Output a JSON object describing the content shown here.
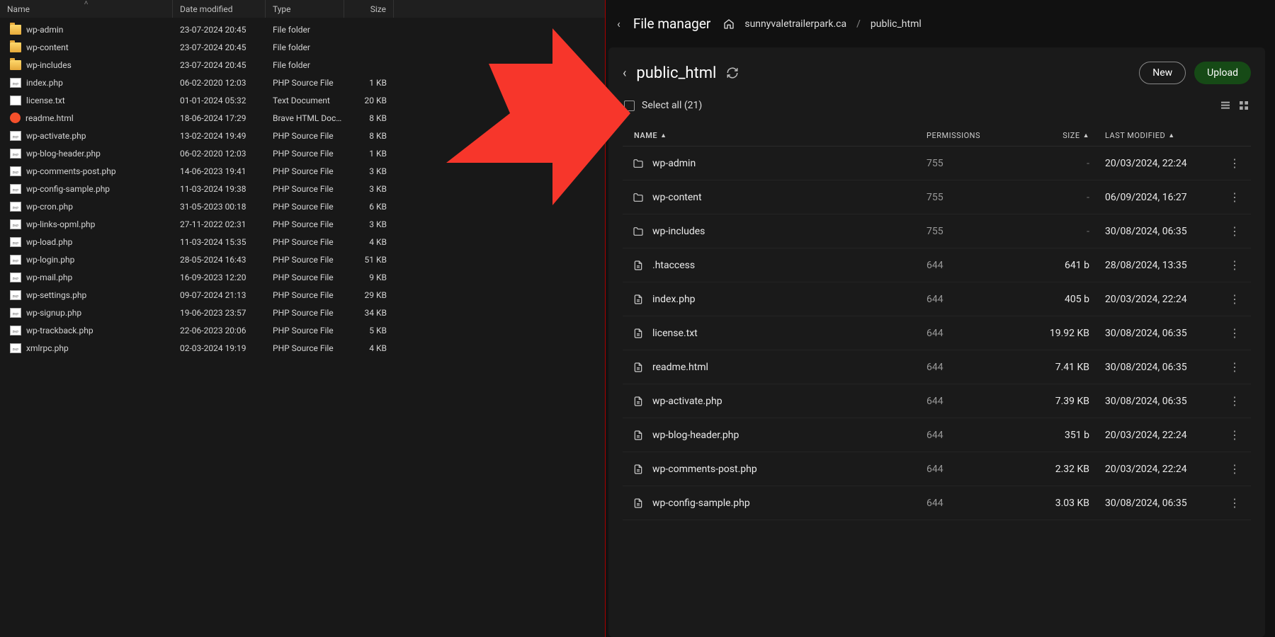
{
  "explorer": {
    "columns": {
      "name": "Name",
      "date": "Date modified",
      "type": "Type",
      "size": "Size"
    },
    "rows": [
      {
        "icon": "folder",
        "name": "wp-admin",
        "date": "23-07-2024 20:45",
        "type": "File folder",
        "size": ""
      },
      {
        "icon": "folder",
        "name": "wp-content",
        "date": "23-07-2024 20:45",
        "type": "File folder",
        "size": ""
      },
      {
        "icon": "folder",
        "name": "wp-includes",
        "date": "23-07-2024 20:45",
        "type": "File folder",
        "size": ""
      },
      {
        "icon": "php",
        "name": "index.php",
        "date": "06-02-2020 12:03",
        "type": "PHP Source File",
        "size": "1 KB"
      },
      {
        "icon": "txt",
        "name": "license.txt",
        "date": "01-01-2024 05:32",
        "type": "Text Document",
        "size": "20 KB"
      },
      {
        "icon": "html",
        "name": "readme.html",
        "date": "18-06-2024 17:29",
        "type": "Brave HTML Docu…",
        "size": "8 KB"
      },
      {
        "icon": "php",
        "name": "wp-activate.php",
        "date": "13-02-2024 19:49",
        "type": "PHP Source File",
        "size": "8 KB"
      },
      {
        "icon": "php",
        "name": "wp-blog-header.php",
        "date": "06-02-2020 12:03",
        "type": "PHP Source File",
        "size": "1 KB"
      },
      {
        "icon": "php",
        "name": "wp-comments-post.php",
        "date": "14-06-2023 19:41",
        "type": "PHP Source File",
        "size": "3 KB"
      },
      {
        "icon": "php",
        "name": "wp-config-sample.php",
        "date": "11-03-2024 19:38",
        "type": "PHP Source File",
        "size": "3 KB"
      },
      {
        "icon": "php",
        "name": "wp-cron.php",
        "date": "31-05-2023 00:18",
        "type": "PHP Source File",
        "size": "6 KB"
      },
      {
        "icon": "php",
        "name": "wp-links-opml.php",
        "date": "27-11-2022 02:31",
        "type": "PHP Source File",
        "size": "3 KB"
      },
      {
        "icon": "php",
        "name": "wp-load.php",
        "date": "11-03-2024 15:35",
        "type": "PHP Source File",
        "size": "4 KB"
      },
      {
        "icon": "php",
        "name": "wp-login.php",
        "date": "28-05-2024 16:43",
        "type": "PHP Source File",
        "size": "51 KB"
      },
      {
        "icon": "php",
        "name": "wp-mail.php",
        "date": "16-09-2023 12:20",
        "type": "PHP Source File",
        "size": "9 KB"
      },
      {
        "icon": "php",
        "name": "wp-settings.php",
        "date": "09-07-2024 21:13",
        "type": "PHP Source File",
        "size": "29 KB"
      },
      {
        "icon": "php",
        "name": "wp-signup.php",
        "date": "19-06-2023 23:57",
        "type": "PHP Source File",
        "size": "34 KB"
      },
      {
        "icon": "php",
        "name": "wp-trackback.php",
        "date": "22-06-2023 20:06",
        "type": "PHP Source File",
        "size": "5 KB"
      },
      {
        "icon": "php",
        "name": "xmlrpc.php",
        "date": "02-03-2024 19:19",
        "type": "PHP Source File",
        "size": "4 KB"
      }
    ]
  },
  "fm": {
    "breadcrumb": {
      "title": "File manager",
      "domain": "sunnyvaletrailerpark.ca",
      "current": "public_html",
      "sep": "/"
    },
    "panel": {
      "folder": "public_html",
      "new": "New",
      "upload": "Upload",
      "select_all": "Select all (21)"
    },
    "columns": {
      "name": "NAME",
      "perm": "PERMISSIONS",
      "size": "SIZE",
      "mod": "LAST MODIFIED"
    },
    "rows": [
      {
        "icon": "folder",
        "name": "wp-admin",
        "perm": "755",
        "size": "-",
        "mod": "20/03/2024, 22:24"
      },
      {
        "icon": "folder",
        "name": "wp-content",
        "perm": "755",
        "size": "-",
        "mod": "06/09/2024, 16:27"
      },
      {
        "icon": "folder",
        "name": "wp-includes",
        "perm": "755",
        "size": "-",
        "mod": "30/08/2024, 06:35"
      },
      {
        "icon": "file",
        "name": ".htaccess",
        "perm": "644",
        "size": "641 b",
        "mod": "28/08/2024, 13:35"
      },
      {
        "icon": "file",
        "name": "index.php",
        "perm": "644",
        "size": "405 b",
        "mod": "20/03/2024, 22:24"
      },
      {
        "icon": "file",
        "name": "license.txt",
        "perm": "644",
        "size": "19.92 KB",
        "mod": "30/08/2024, 06:35"
      },
      {
        "icon": "file",
        "name": "readme.html",
        "perm": "644",
        "size": "7.41 KB",
        "mod": "30/08/2024, 06:35"
      },
      {
        "icon": "file",
        "name": "wp-activate.php",
        "perm": "644",
        "size": "7.39 KB",
        "mod": "30/08/2024, 06:35"
      },
      {
        "icon": "file",
        "name": "wp-blog-header.php",
        "perm": "644",
        "size": "351 b",
        "mod": "20/03/2024, 22:24"
      },
      {
        "icon": "file",
        "name": "wp-comments-post.php",
        "perm": "644",
        "size": "2.32 KB",
        "mod": "20/03/2024, 22:24"
      },
      {
        "icon": "file",
        "name": "wp-config-sample.php",
        "perm": "644",
        "size": "3.03 KB",
        "mod": "30/08/2024, 06:35"
      }
    ]
  }
}
